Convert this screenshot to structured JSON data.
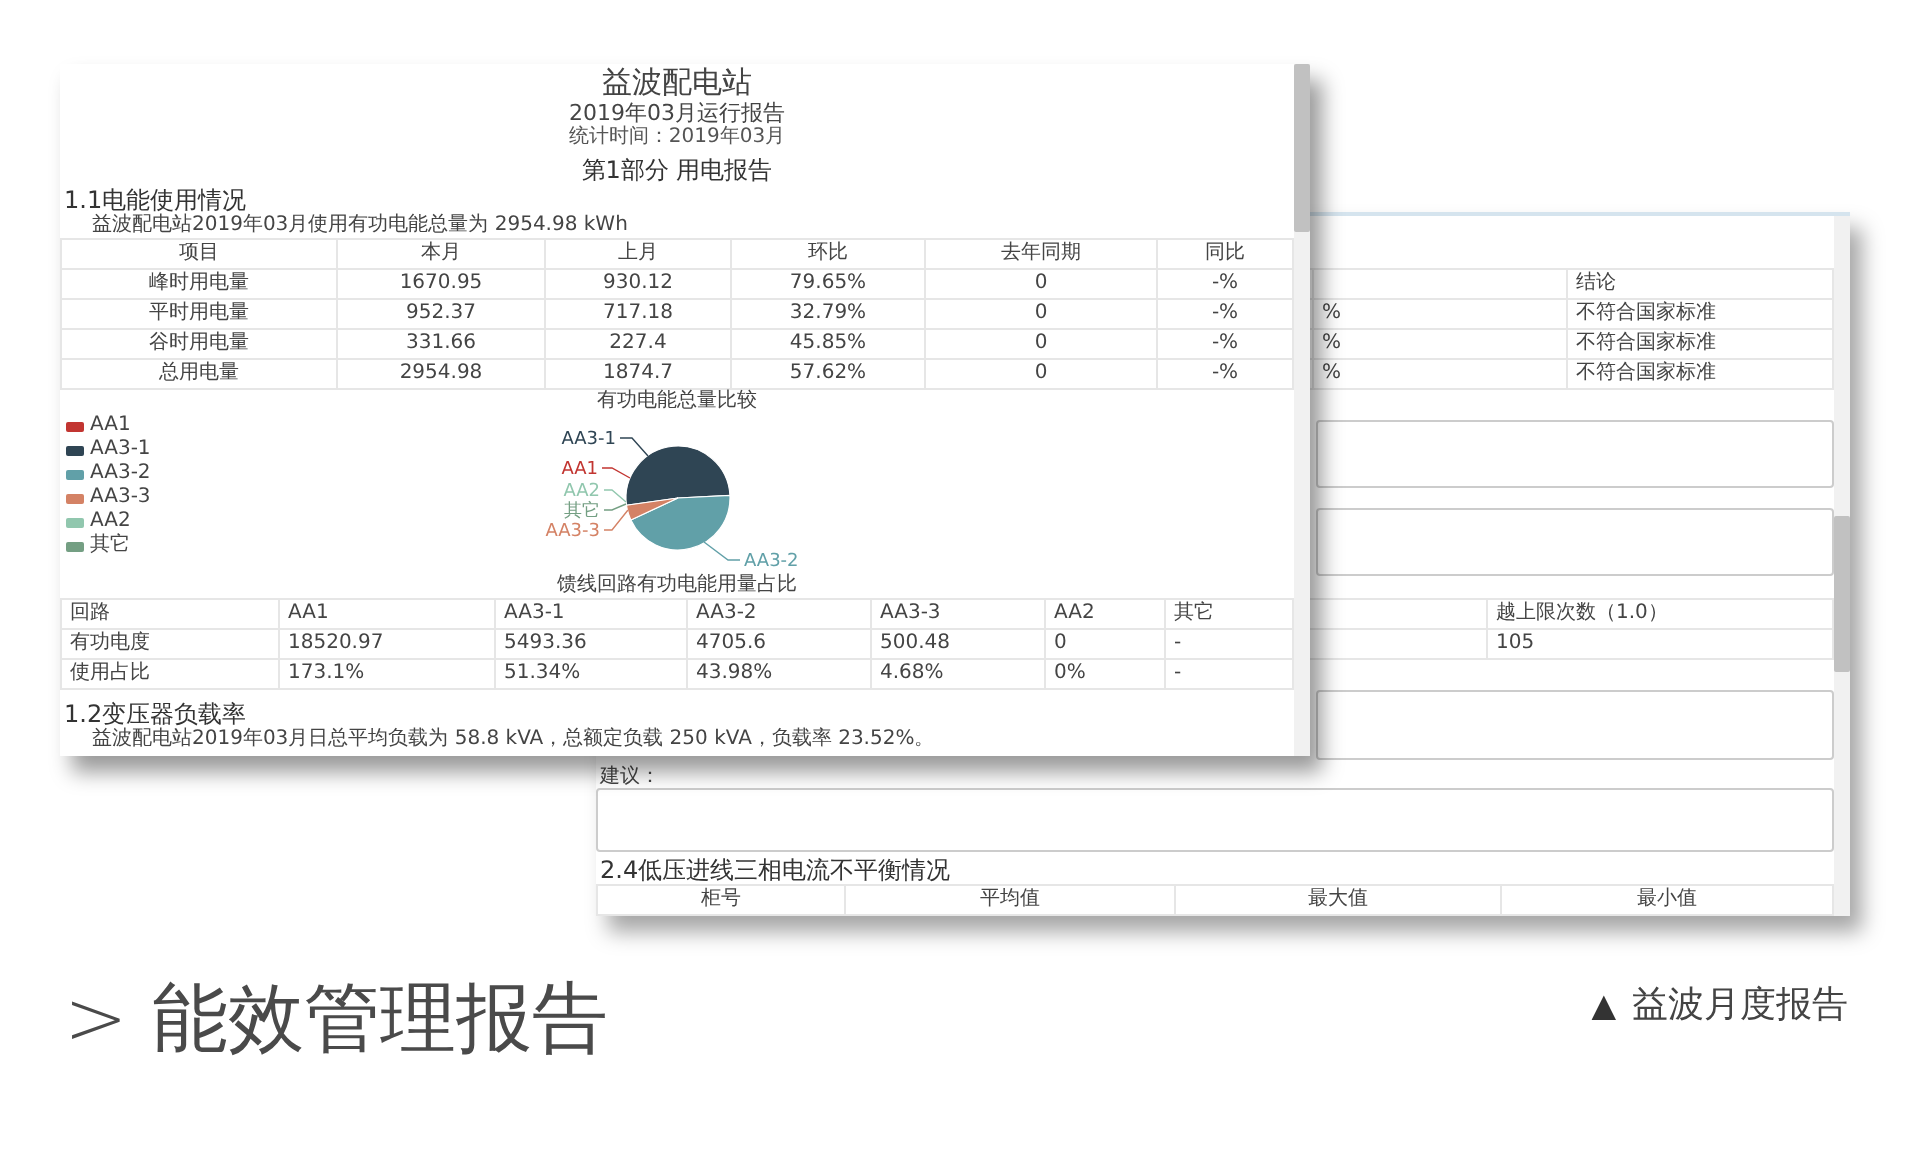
{
  "back_report": {
    "compliance_table": {
      "header": {
        "conclusion": "结论"
      },
      "rows": [
        {
          "value": "%",
          "conclusion": "不符合国家标准"
        },
        {
          "value": "%",
          "conclusion": "不符合国家标准"
        },
        {
          "value": "%",
          "conclusion": "不符合国家标准"
        }
      ]
    },
    "over_limit_table": {
      "header": "越上限次数（1.0）",
      "value": "105"
    },
    "advice_label": "建议：",
    "section_2_4": {
      "heading": "2.4低压进线三相电流不平衡情况",
      "columns": [
        "柜号",
        "平均值",
        "最大值",
        "最小值"
      ]
    }
  },
  "front_report": {
    "title": "益波配电站",
    "subtitle": "2019年03月运行报告",
    "period": "统计时间：2019年03月",
    "part_title": "第1部分 用电报告",
    "section_1_1": {
      "heading": "1.1电能使用情况",
      "summary": "益波配电站2019年03月使用有功电能总量为 2954.98 kWh",
      "table": {
        "columns": [
          "项目",
          "本月",
          "上月",
          "环比",
          "去年同期",
          "同比"
        ],
        "rows": [
          [
            "峰时用电量",
            "1670.95",
            "930.12",
            "79.65%",
            "0",
            "-%"
          ],
          [
            "平时用电量",
            "952.37",
            "717.18",
            "32.79%",
            "0",
            "-%"
          ],
          [
            "谷时用电量",
            "331.66",
            "227.4",
            "45.85%",
            "0",
            "-%"
          ],
          [
            "总用电量",
            "2954.98",
            "1874.7",
            "57.62%",
            "0",
            "-%"
          ]
        ]
      }
    },
    "chart": {
      "title": "有功电能总量比较",
      "legend": [
        {
          "label": "AA1",
          "color": "#c23531"
        },
        {
          "label": "AA3-1",
          "color": "#2f4554"
        },
        {
          "label": "AA3-2",
          "color": "#61a0a8"
        },
        {
          "label": "AA3-3",
          "color": "#d48265"
        },
        {
          "label": "AA2",
          "color": "#91c7ae"
        },
        {
          "label": "其它",
          "color": "#749f83"
        }
      ],
      "slice_labels": [
        {
          "label": "AA3-1",
          "color": "#2f4554"
        },
        {
          "label": "AA1",
          "color": "#c23531"
        },
        {
          "label": "AA2",
          "color": "#91c7ae"
        },
        {
          "label": "其它",
          "color": "#749f83"
        },
        {
          "label": "AA3-3",
          "color": "#d48265"
        },
        {
          "label": "AA3-2",
          "color": "#61a0a8"
        }
      ],
      "caption": "馈线回路有功电能用量占比"
    },
    "circuit_table": {
      "rows": [
        [
          "回路",
          "AA1",
          "AA3-1",
          "AA3-2",
          "AA3-3",
          "AA2",
          "其它"
        ],
        [
          "有功电度",
          "18520.97",
          "5493.36",
          "4705.6",
          "500.48",
          "0",
          "-"
        ],
        [
          "使用占比",
          "173.1%",
          "51.34%",
          "43.98%",
          "4.68%",
          "0%",
          "-"
        ]
      ]
    },
    "section_1_2": {
      "heading": "1.2变压器负载率",
      "summary": "益波配电站2019年03月日总平均负载为 58.8 kVA，总额定负载 250 kVA，负载率 23.52%。"
    }
  },
  "caption": {
    "text": "> 能效管理报告"
  },
  "product_label": {
    "marker": "▲",
    "text": "益波月度报告"
  }
}
